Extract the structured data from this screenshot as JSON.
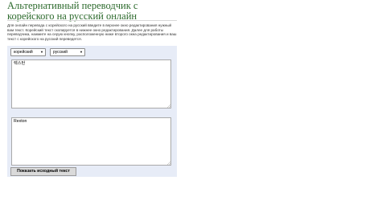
{
  "page": {
    "title": "Альтернативный переводчик с корейского на русский онлайн",
    "description": "Для онлайн перевода с корейского на русский введите в верхнее окно редактирования нужный вам текст. Корейский текст скопируется в нижнее окно редактирования. Далее для работы переводчика, нажмите на серую кнопку, расположенную ниже второго окна редактирования и ваш текст с корейского на русский переведется."
  },
  "translator": {
    "source_language": "корейский",
    "target_language": "русский",
    "source_text": "렉스턴",
    "target_text": "Rexton",
    "show_source_label": "Показать исходный текст"
  },
  "icons": {
    "dropdown": "chevron-down-icon",
    "resize": "resize-grip-icon"
  },
  "colors": {
    "title": "#2e6b2e",
    "panel_background": "#e7ecf7",
    "button_background": "#dadada"
  }
}
